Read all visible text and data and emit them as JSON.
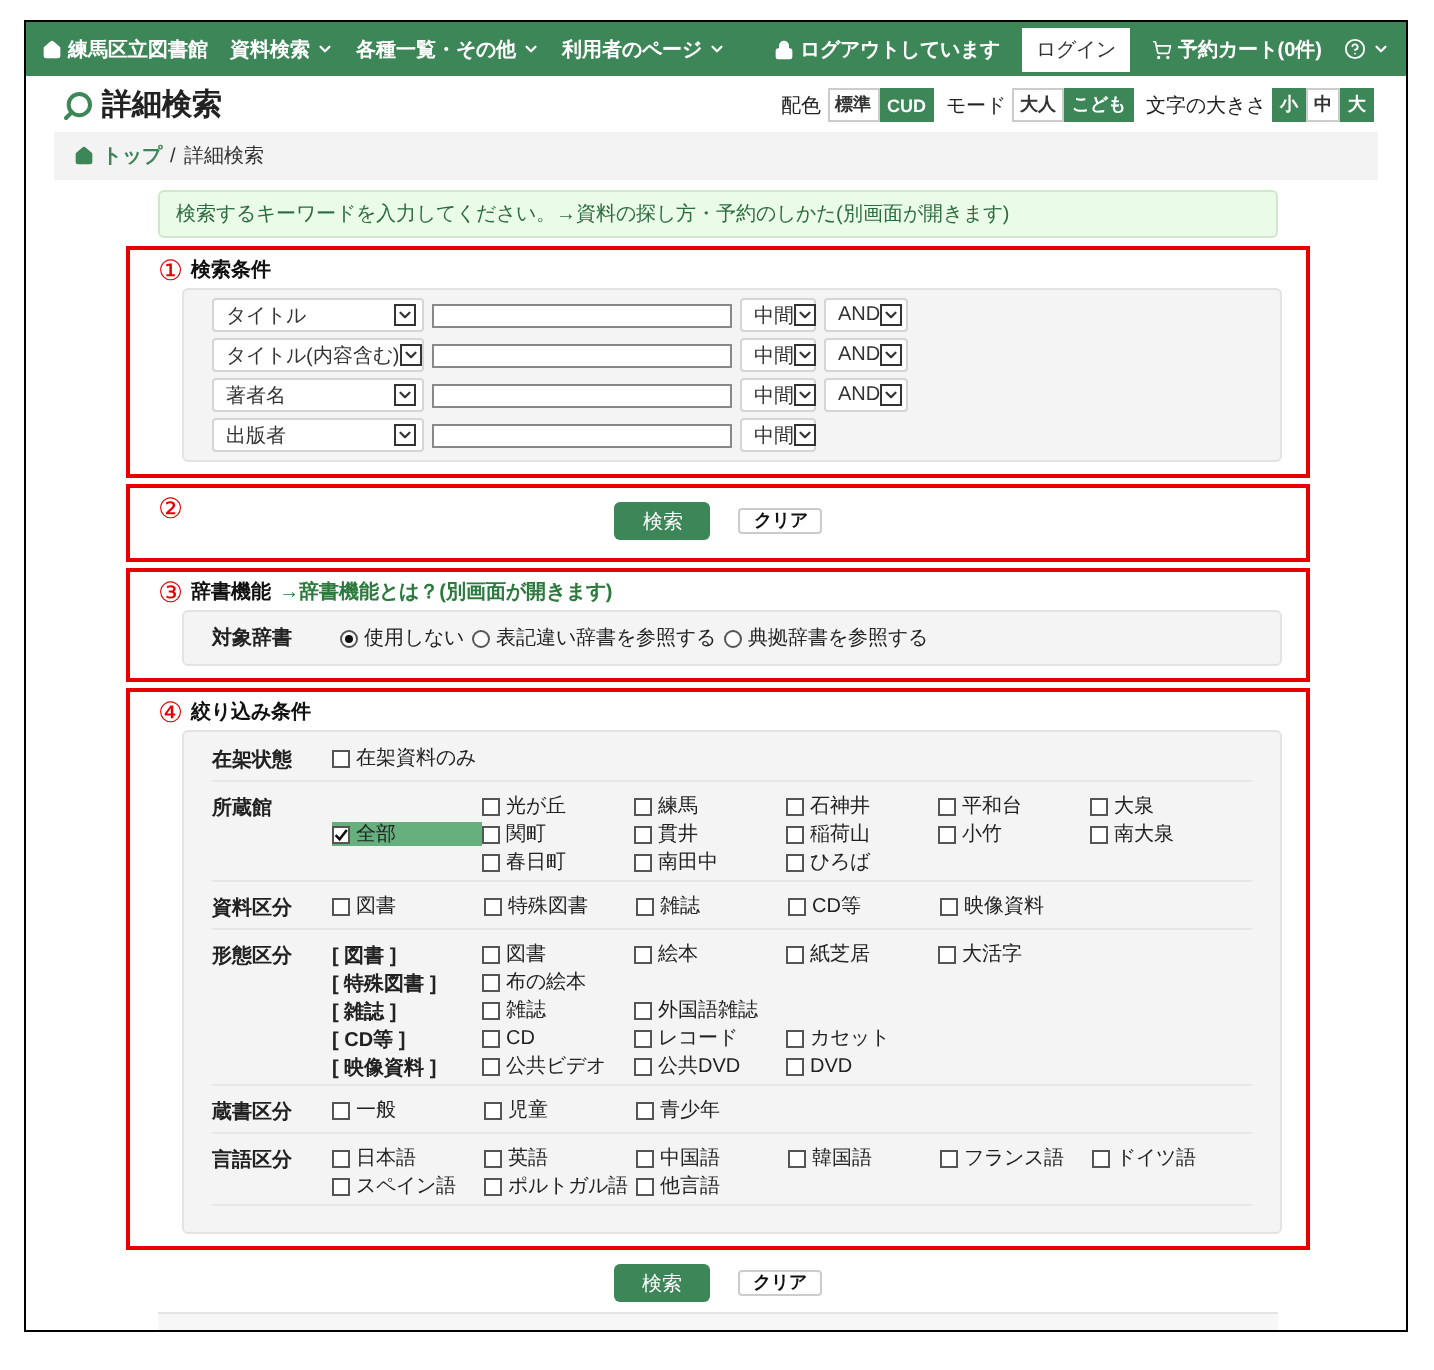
{
  "header": {
    "site": "練馬区立図書館",
    "menus": [
      {
        "label": "資料検索"
      },
      {
        "label": "各種一覧・その他"
      },
      {
        "label": "利用者のページ"
      }
    ],
    "login_status": "ログアウトしています",
    "login": "ログイン",
    "cart": "予約カート(0件)"
  },
  "page_title": "詳細検索",
  "display_options": [
    {
      "label": "配色",
      "options": [
        {
          "label": "標準",
          "selected": true
        },
        {
          "label": "CUD",
          "selected": false
        }
      ]
    },
    {
      "label": "モード",
      "options": [
        {
          "label": "大人",
          "selected": true
        },
        {
          "label": "こども",
          "selected": false
        }
      ]
    },
    {
      "label": "文字の大きさ",
      "options": [
        {
          "label": "小",
          "selected": false
        },
        {
          "label": "中",
          "selected": true
        },
        {
          "label": "大",
          "selected": false
        }
      ]
    }
  ],
  "breadcrumb": {
    "separator": "/",
    "items": [
      {
        "label": "トップ"
      },
      {
        "label": "詳細検索"
      }
    ]
  },
  "notice": {
    "text": "検索するキーワードを入力してください。",
    "link": "→資料の探し方・予約のしかた(別画面が開きます)"
  },
  "search_conditions": {
    "marker": "①",
    "title": "検索条件",
    "rows": [
      {
        "field": "タイトル",
        "match": "中間",
        "operator": "AND"
      },
      {
        "field": "タイトル(内容含む)",
        "match": "中間",
        "operator": "AND"
      },
      {
        "field": "著者名",
        "match": "中間",
        "operator": "AND"
      },
      {
        "field": "出版者",
        "match": "中間"
      }
    ]
  },
  "actions": {
    "marker": "②",
    "search": "検索",
    "clear": "クリア"
  },
  "dictionary": {
    "marker": "③",
    "title": "辞書機能",
    "link": "→辞書機能とは？(別画面が開きます)",
    "label": "対象辞書",
    "options": [
      {
        "label": "使用しない",
        "selected": true
      },
      {
        "label": "表記違い辞書を参照する",
        "selected": false
      },
      {
        "label": "典拠辞書を参照する",
        "selected": false
      }
    ]
  },
  "filters": {
    "marker": "④",
    "title": "絞り込み条件",
    "groups": [
      {
        "kind": "simple",
        "label": "在架状態",
        "items": [
          {
            "label": "在架資料のみ",
            "checked": false
          }
        ]
      },
      {
        "kind": "branches",
        "label": "所蔵館",
        "all": {
          "label": "全部",
          "checked": true
        },
        "items": [
          {
            "label": "光が丘",
            "checked": false
          },
          {
            "label": "練馬",
            "checked": false
          },
          {
            "label": "石神井",
            "checked": false
          },
          {
            "label": "平和台",
            "checked": false
          },
          {
            "label": "大泉",
            "checked": false
          },
          {
            "label": "関町",
            "checked": false
          },
          {
            "label": "貫井",
            "checked": false
          },
          {
            "label": "稲荷山",
            "checked": false
          },
          {
            "label": "小竹",
            "checked": false
          },
          {
            "label": "南大泉",
            "checked": false
          },
          {
            "label": "春日町",
            "checked": false
          },
          {
            "label": "南田中",
            "checked": false
          },
          {
            "label": "ひろば",
            "checked": false
          }
        ]
      },
      {
        "kind": "simple",
        "label": "資料区分",
        "items": [
          {
            "label": "図書",
            "checked": false
          },
          {
            "label": "特殊図書",
            "checked": false
          },
          {
            "label": "雑誌",
            "checked": false
          },
          {
            "label": "CD等",
            "checked": false
          },
          {
            "label": "映像資料",
            "checked": false
          }
        ]
      },
      {
        "kind": "sub",
        "label": "形態区分",
        "subgroups": [
          {
            "label": "[ 図書 ]",
            "items": [
              {
                "label": "図書",
                "checked": false
              },
              {
                "label": "絵本",
                "checked": false
              },
              {
                "label": "紙芝居",
                "checked": false
              },
              {
                "label": "大活字",
                "checked": false
              }
            ]
          },
          {
            "label": "[ 特殊図書 ]",
            "items": [
              {
                "label": "布の絵本",
                "checked": false
              }
            ]
          },
          {
            "label": "[ 雑誌 ]",
            "items": [
              {
                "label": "雑誌",
                "checked": false
              },
              {
                "label": "外国語雑誌",
                "checked": false
              }
            ]
          },
          {
            "label": "[ CD等 ]",
            "items": [
              {
                "label": "CD",
                "checked": false
              },
              {
                "label": "レコード",
                "checked": false
              },
              {
                "label": "カセット",
                "checked": false
              }
            ]
          },
          {
            "label": "[ 映像資料 ]",
            "items": [
              {
                "label": "公共ビデオ",
                "checked": false
              },
              {
                "label": "公共DVD",
                "checked": false
              },
              {
                "label": "DVD",
                "checked": false
              }
            ]
          }
        ]
      },
      {
        "kind": "simple",
        "label": "蔵書区分",
        "items": [
          {
            "label": "一般",
            "checked": false
          },
          {
            "label": "児童",
            "checked": false
          },
          {
            "label": "青少年",
            "checked": false
          }
        ]
      },
      {
        "kind": "simple",
        "label": "言語区分",
        "items": [
          {
            "label": "日本語",
            "checked": false
          },
          {
            "label": "英語",
            "checked": false
          },
          {
            "label": "中国語",
            "checked": false
          },
          {
            "label": "韓国語",
            "checked": false
          },
          {
            "label": "フランス語",
            "checked": false
          },
          {
            "label": "ドイツ語",
            "checked": false
          },
          {
            "label": "スペイン語",
            "checked": false
          },
          {
            "label": "ポルトガル語",
            "checked": false
          },
          {
            "label": "他言語",
            "checked": false
          }
        ]
      }
    ]
  },
  "bottom_actions": {
    "search": "検索",
    "clear": "クリア"
  }
}
